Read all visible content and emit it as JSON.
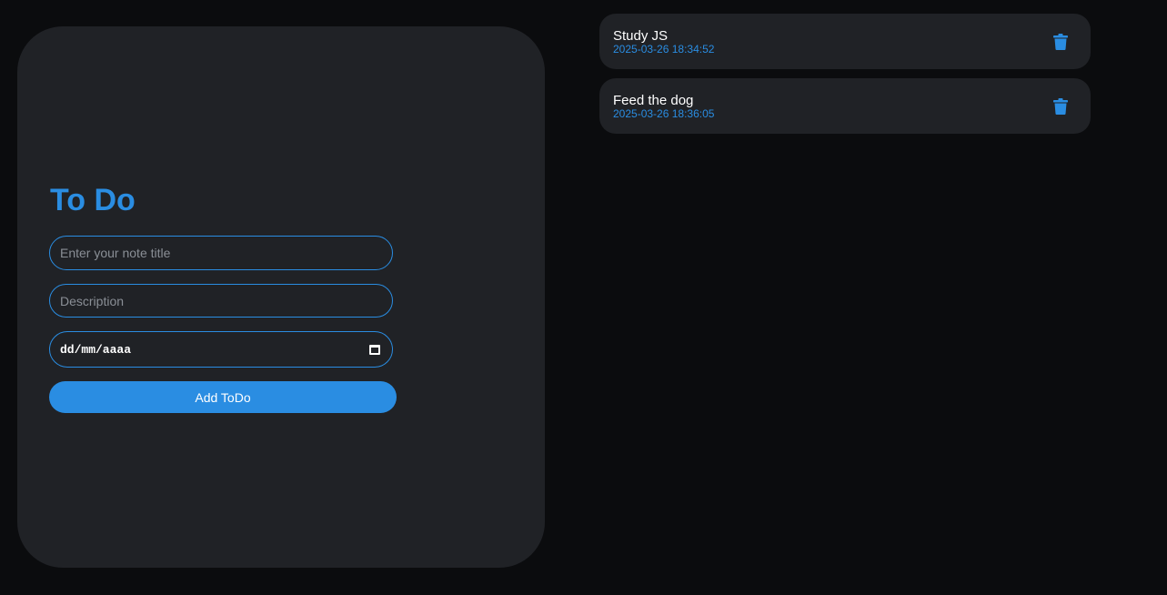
{
  "form": {
    "title": "To Do",
    "title_placeholder": "Enter your note title",
    "description_placeholder": "Description",
    "date_placeholder": "dd/mm/aaaa",
    "add_button_label": "Add ToDo"
  },
  "todos": [
    {
      "title": "Study JS",
      "date": "2025-03-26 18:34:52",
      "icon": "trash-icon"
    },
    {
      "title": "Feed the dog",
      "date": "2025-03-26 18:36:05",
      "icon": "trash-icon"
    }
  ],
  "colors": {
    "background": "#0b0c0e",
    "card": "#202226",
    "accent": "#2a8de2",
    "text": "#ffffff",
    "placeholder": "#8a8f96"
  }
}
